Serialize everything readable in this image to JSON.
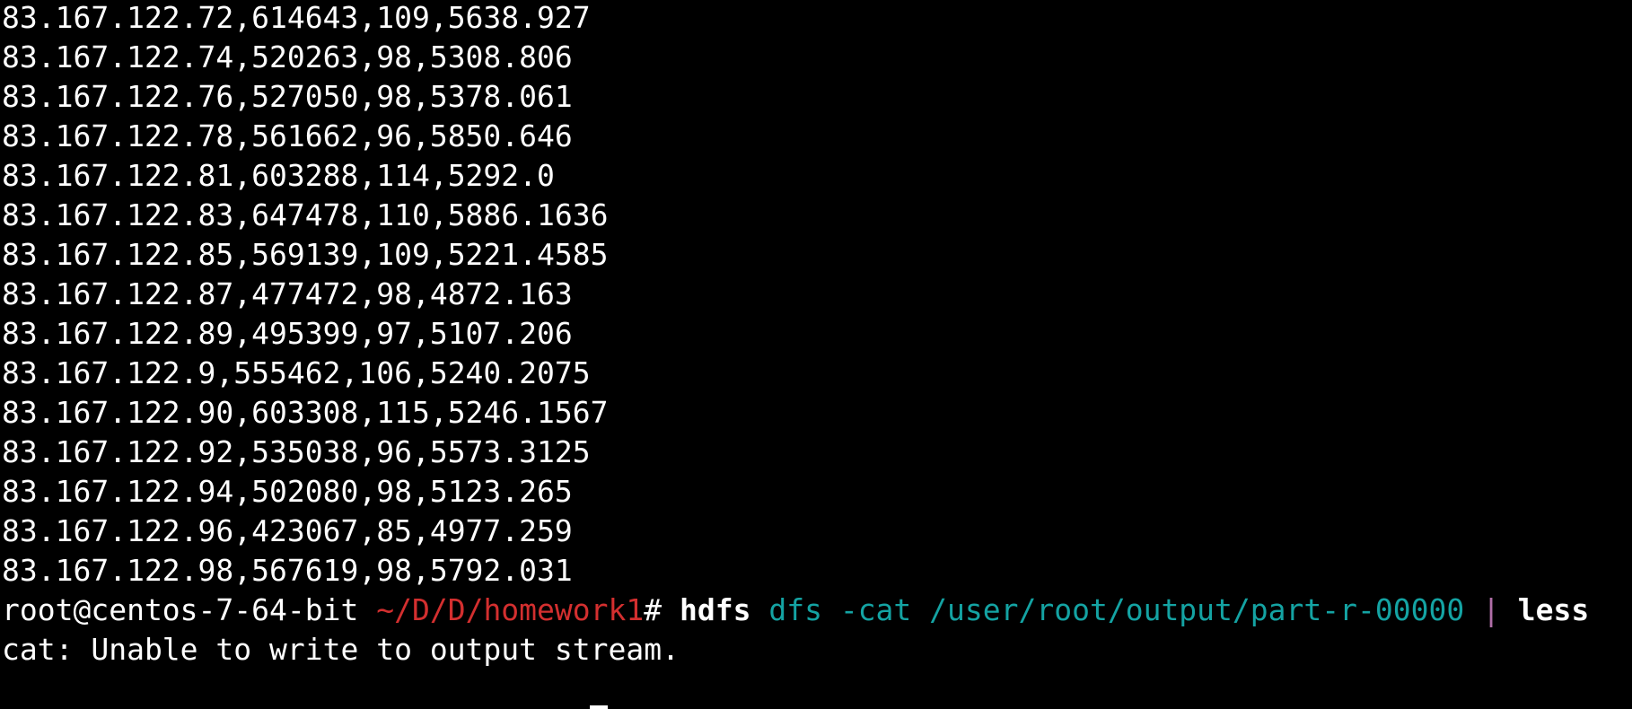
{
  "output_lines": [
    "83.167.122.72,614643,109,5638.927",
    "83.167.122.74,520263,98,5308.806",
    "83.167.122.76,527050,98,5378.061",
    "83.167.122.78,561662,96,5850.646",
    "83.167.122.81,603288,114,5292.0",
    "83.167.122.83,647478,110,5886.1636",
    "83.167.122.85,569139,109,5221.4585",
    "83.167.122.87,477472,98,4872.163",
    "83.167.122.89,495399,97,5107.206",
    "83.167.122.9,555462,106,5240.2075",
    "83.167.122.90,603308,115,5246.1567",
    "83.167.122.92,535038,96,5573.3125",
    "83.167.122.94,502080,98,5123.265",
    "83.167.122.96,423067,85,4977.259",
    "83.167.122.98,567619,98,5792.031"
  ],
  "prompt": {
    "user_host": "root@centos-7-64-bit ",
    "path": "~/D/D/homework1",
    "symbol": "# ",
    "command": "hdfs",
    "args": " dfs -cat /user/root/output/part-r-00000 ",
    "pipe": "|",
    "pipe_target": " less"
  },
  "error_line": "cat: Unable to write to output stream.",
  "colors": {
    "background": "#000000",
    "foreground": "#ffffff",
    "path": "#d32f2f",
    "args": "#14a3a3",
    "pipe": "#b06fa8"
  }
}
